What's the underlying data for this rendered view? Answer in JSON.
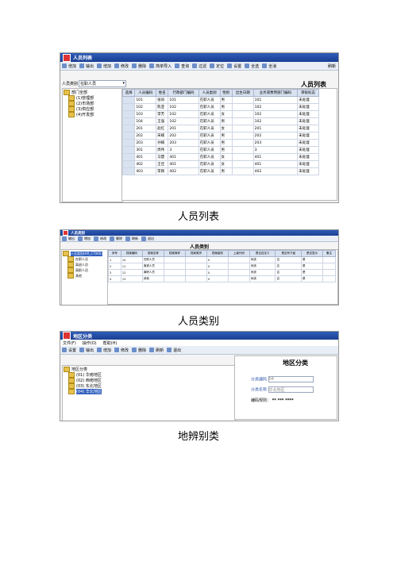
{
  "shot1": {
    "title": "人员列表",
    "toolbar": [
      "增加",
      "输出",
      "增加",
      "修改",
      "删除",
      "简单导入",
      "查询",
      "过滤",
      "定位",
      "设置",
      "全选",
      "全消"
    ],
    "refresh": "刷新",
    "type_label": "人员类别",
    "type_value": "在职人员",
    "heading": "人员列表",
    "tree": [
      "部门全部",
      "(1)管理部",
      "(2)市场部",
      "(3)供应部",
      "(4)开发部"
    ],
    "columns": [
      "选择",
      "人员编码",
      "姓名",
      "行政部门编码",
      "人员类别",
      "性别",
      "出生日期",
      "业务或费用部门编码",
      "审核标志"
    ],
    "rows": [
      [
        "",
        "101",
        "张同",
        "101",
        "在职人员",
        "男",
        "",
        "101",
        "未处理"
      ],
      [
        "",
        "102",
        "陈亚",
        "102",
        "在职人员",
        "男",
        "",
        "102",
        "未处理"
      ],
      [
        "",
        "103",
        "李芳",
        "102",
        "在职人员",
        "女",
        "",
        "102",
        "未处理"
      ],
      [
        "",
        "104",
        "王强",
        "102",
        "在职人员",
        "男",
        "",
        "102",
        "未处理"
      ],
      [
        "",
        "201",
        "赵红",
        "201",
        "在职人员",
        "女",
        "",
        "201",
        "未处理"
      ],
      [
        "",
        "202",
        "宋楠",
        "202",
        "在职人员",
        "男",
        "",
        "202",
        "未处理"
      ],
      [
        "",
        "203",
        "孙楠",
        "203",
        "在职人员",
        "男",
        "",
        "203",
        "未处理"
      ],
      [
        "",
        "301",
        "周伟",
        "3",
        "在职人员",
        "男",
        "",
        "3",
        "未处理"
      ],
      [
        "",
        "401",
        "马慧",
        "401",
        "在职人员",
        "女",
        "",
        "401",
        "未处理"
      ],
      [
        "",
        "402",
        "王佳",
        "401",
        "在职人员",
        "女",
        "",
        "401",
        "未处理"
      ],
      [
        "",
        "403",
        "李刚",
        "402",
        "在职人员",
        "男",
        "",
        "402",
        "未处理"
      ]
    ]
  },
  "caption1": "人员列表",
  "shot2": {
    "title": "人员类别",
    "toolbar": [
      "输出",
      "增加",
      "修改",
      "删除",
      "刷新",
      "退出"
    ],
    "heading": "人员类别",
    "tree": [
      "人员类别(HR_CT000)",
      "在职人员",
      "离退人员",
      "离职人员",
      "其他"
    ],
    "columns": [
      "序号",
      "档案编码",
      "档案名称",
      "档案简称",
      "档案简拼",
      "档案级别",
      "上级代码",
      "是否自定义",
      "是否有下级",
      "是否显示",
      "备注"
    ],
    "rows": [
      [
        "1",
        "10",
        "在职人员",
        "",
        "",
        "0",
        "",
        "系统",
        "否",
        "是",
        ""
      ],
      [
        "2",
        "11",
        "离退人员",
        "",
        "",
        "0",
        "",
        "系统",
        "否",
        "是",
        ""
      ],
      [
        "3",
        "12",
        "离职人员",
        "",
        "",
        "0",
        "",
        "系统",
        "否",
        "是",
        ""
      ],
      [
        "4",
        "13",
        "其他",
        "",
        "",
        "0",
        "",
        "系统",
        "否",
        "是",
        ""
      ]
    ]
  },
  "caption2": "人员类别",
  "shot3": {
    "title": "地区分类",
    "menu": [
      "文件(F)",
      "操作(O)",
      "帮助(H)"
    ],
    "toolbar": [
      "设置",
      "输出",
      "增加",
      "修改",
      "删除",
      "刷新",
      "退出"
    ],
    "heading": "地区分类",
    "tree": [
      "地区分类",
      "(01) 华南地区",
      "(02) 西南地区",
      "(03) 东北地区",
      "(04) 华北地区"
    ],
    "code_label": "分类编码",
    "code_value": "04",
    "name_label": "分类名称",
    "name_value": "华北地区",
    "rule_label": "编码规则：",
    "rule_value": "** *** ****"
  },
  "caption3": "地辨别类",
  "colors": {
    "title_bar": "#1b3f93",
    "selected": "#2f5fbf",
    "header_bg": "#d8e2f1"
  }
}
